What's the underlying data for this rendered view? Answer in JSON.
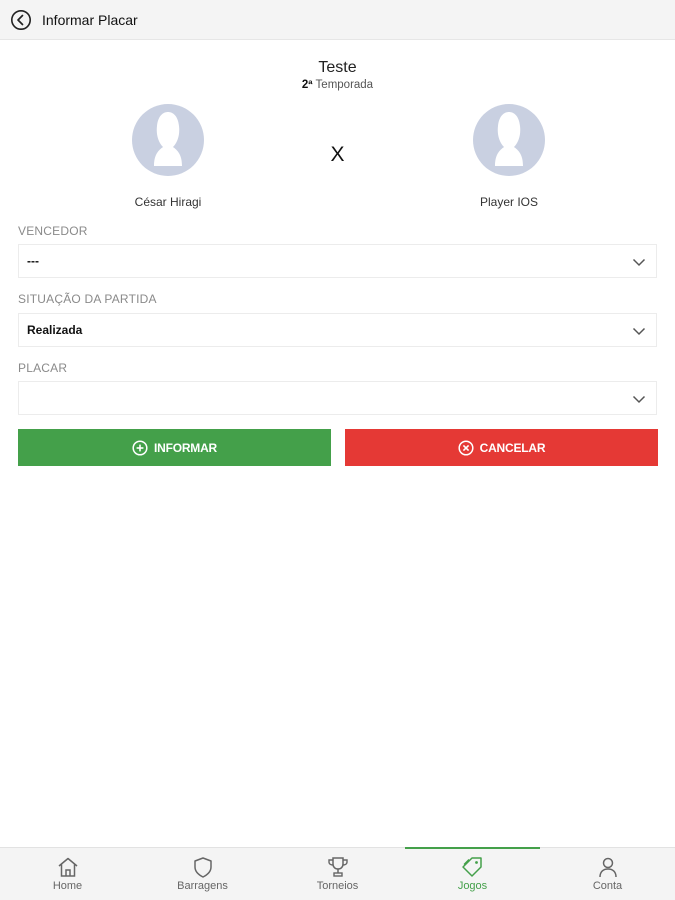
{
  "header": {
    "title": "Informar Placar"
  },
  "match": {
    "tournament": "Teste",
    "season_number": "2ª",
    "season_label": "Temporada",
    "versus": "X",
    "player1": "César Hiragi",
    "player2": "Player IOS"
  },
  "form": {
    "winner_label": "VENCEDOR",
    "winner_value": "---",
    "status_label": "SITUAÇÃO DA PARTIDA",
    "status_value": "Realizada",
    "score_label": "PLACAR",
    "score_value": ""
  },
  "actions": {
    "submit": "INFORMAR",
    "cancel": "CANCELAR"
  },
  "nav": {
    "home": "Home",
    "barragens": "Barragens",
    "torneios": "Torneios",
    "jogos": "Jogos",
    "conta": "Conta",
    "active": "jogos"
  },
  "colors": {
    "accent": "#44a04a",
    "danger": "#e53935",
    "avatar": "#c9d0e1"
  }
}
